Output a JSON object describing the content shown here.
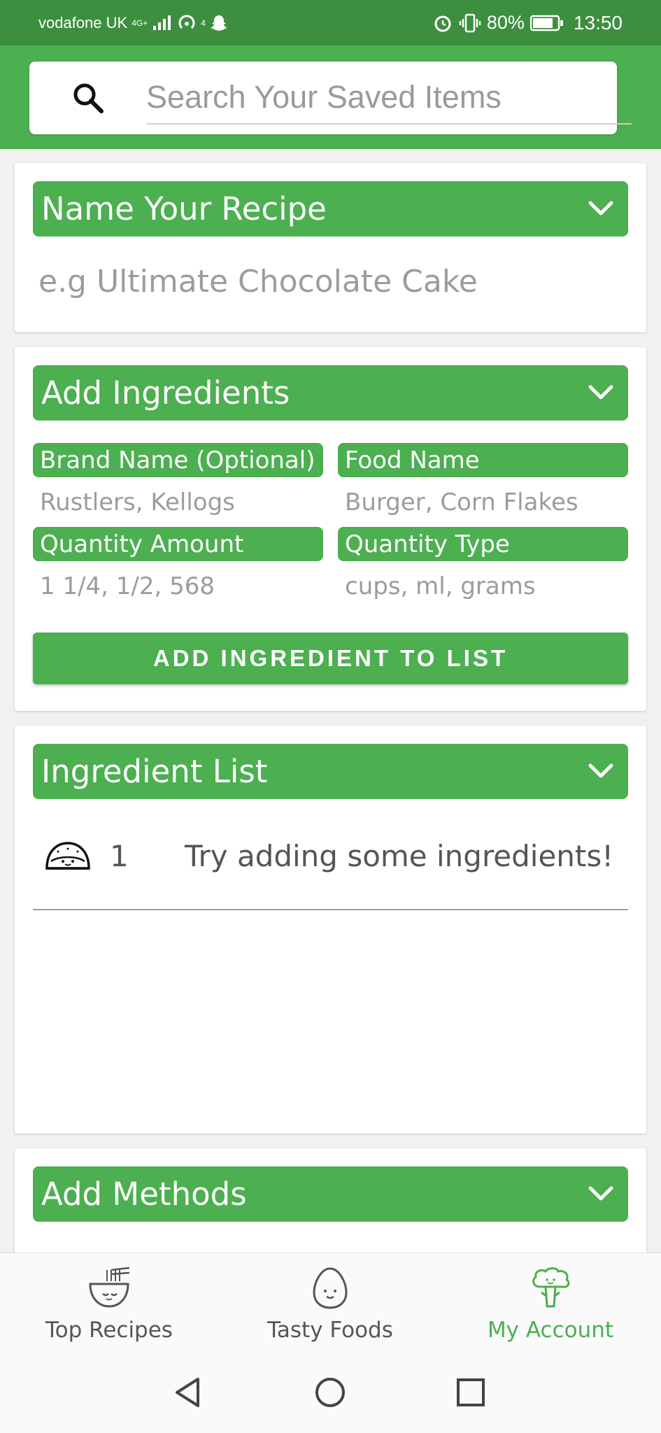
{
  "status_bar": {
    "carrier": "vodafone UK",
    "network": "4G+",
    "hotspot_count": "4",
    "battery": "80%",
    "time": "13:50"
  },
  "search": {
    "placeholder": "Search Your Saved Items"
  },
  "recipe_name": {
    "header": "Name Your Recipe",
    "placeholder": "e.g Ultimate Chocolate Cake"
  },
  "add_ingredients": {
    "header": "Add Ingredients",
    "brand_label": "Brand Name (Optional)",
    "brand_placeholder": "Rustlers, Kellogs",
    "food_label": "Food Name",
    "food_placeholder": "Burger, Corn Flakes",
    "qty_amount_label": "Quantity Amount",
    "qty_amount_placeholder": "1 1/4, 1/2, 568",
    "qty_type_label": "Quantity Type",
    "qty_type_placeholder": "cups, ml, grams",
    "add_button": "ADD INGREDIENT TO LIST"
  },
  "ingredient_list": {
    "header": "Ingredient List",
    "items": [
      {
        "number": "1",
        "text": "Try adding some ingredients!",
        "icon": "taco-icon"
      }
    ]
  },
  "add_methods": {
    "header": "Add Methods"
  },
  "bottom_nav": {
    "items": [
      {
        "label": "Top Recipes",
        "icon": "ramen-bowl-icon"
      },
      {
        "label": "Tasty Foods",
        "icon": "egg-icon"
      },
      {
        "label": "My Account",
        "icon": "broccoli-icon",
        "active": true
      }
    ]
  },
  "colors": {
    "primary": "#4caf50",
    "status_bar": "#3d8f3f",
    "text_muted": "#9c9c9c"
  }
}
